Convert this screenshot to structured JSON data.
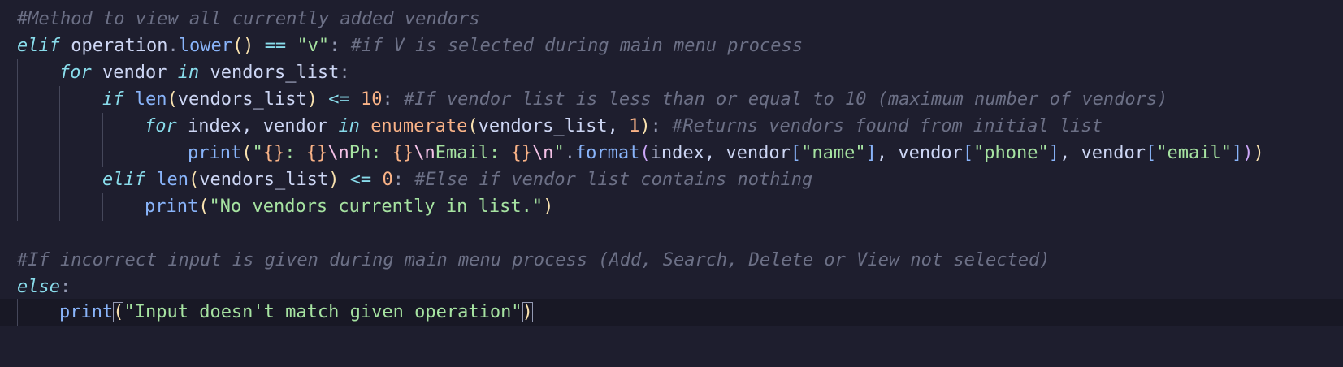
{
  "code": {
    "l1": {
      "comment": "#Method to view all currently added vendors"
    },
    "l2": {
      "kw": "elif",
      "var": "operation",
      "dot": ".",
      "method": "lower",
      "paren": "()",
      "op": "==",
      "str": "\"v\"",
      "colon": ":",
      "comment": "#if V is selected during main menu process"
    },
    "l3": {
      "kw": "for",
      "var": "vendor",
      "kw2": "in",
      "iter": "vendors_list",
      "colon": ":"
    },
    "l4": {
      "kw": "if",
      "fn": "len",
      "open": "(",
      "arg": "vendors_list",
      "close": ")",
      "op": "<=",
      "num": "10",
      "colon": ":",
      "comment": "#If vendor list is less than or equal to 10 (maximum number of vendors)"
    },
    "l5": {
      "kw": "for",
      "vars": "index, vendor",
      "kw2": "in",
      "fn": "enumerate",
      "open": "(",
      "arg": "vendors_list, ",
      "num": "1",
      "close": ")",
      "colon": ":",
      "comment": "#Returns vendors found from initial list"
    },
    "l6": {
      "fn": "print",
      "open": "(",
      "q1": "\"",
      "f1": "{}",
      "s1": ": ",
      "f2": "{}",
      "e1": "\\n",
      "s2": "Ph: ",
      "f3": "{}",
      "e2": "\\n",
      "s3": "Email: ",
      "f4": "{}",
      "e3": "\\n",
      "q2": "\"",
      "dot": ".",
      "method": "format",
      "open2": "(",
      "a1": "index, vendor",
      "ob1": "[",
      "k1": "\"name\"",
      "cb1": "]",
      "sep1": ", vendor",
      "ob2": "[",
      "k2": "\"phone\"",
      "cb2": "]",
      "sep2": ", vendor",
      "ob3": "[",
      "k3": "\"email\"",
      "cb3": "]",
      "close2": ")",
      "close": ")"
    },
    "l7": {
      "kw": "elif",
      "fn": "len",
      "open": "(",
      "arg": "vendors_list",
      "close": ")",
      "op": "<=",
      "num": "0",
      "colon": ":",
      "comment": "#Else if vendor list contains nothing"
    },
    "l8": {
      "fn": "print",
      "open": "(",
      "str": "\"No vendors currently in list.\"",
      "close": ")"
    },
    "l10": {
      "comment": "#If incorrect input is given during main menu process (Add, Search, Delete or View not selected)"
    },
    "l11": {
      "kw": "else",
      "colon": ":"
    },
    "l12": {
      "fn": "print",
      "open": "(",
      "str": "\"Input doesn't match given operation\"",
      "close": ")"
    }
  }
}
